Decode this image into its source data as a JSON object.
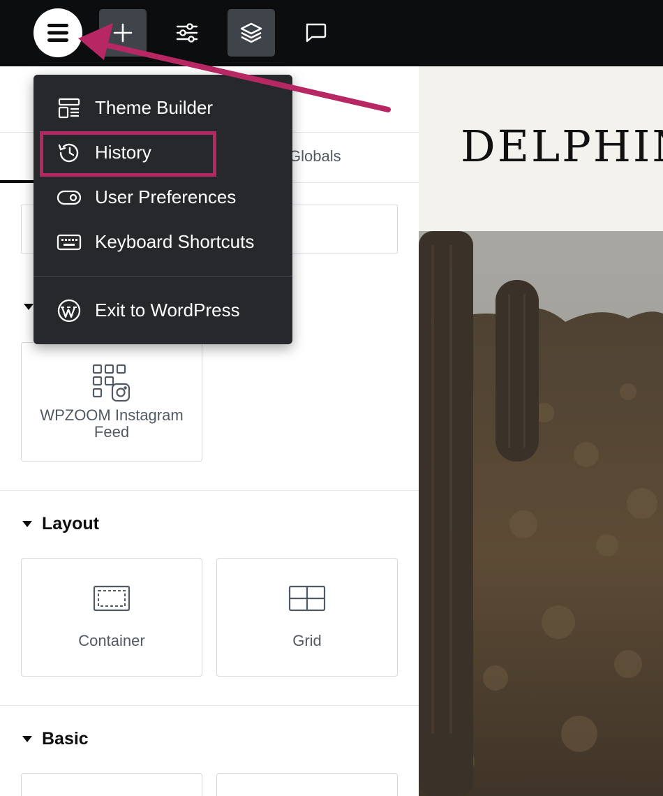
{
  "toolbar": {
    "menu_icon": "hamburger-menu-icon",
    "add_icon": "plus-icon",
    "settings_icon": "sliders-icon",
    "structure_icon": "layers-icon",
    "comments_icon": "comment-icon"
  },
  "panel": {
    "tabs": {
      "globals_label": "Globals"
    },
    "sections": [
      {
        "widgets": [
          {
            "label": "WPZOOM Instagram Feed",
            "icon": "instagram-grid-icon"
          }
        ]
      },
      {
        "title": "Layout",
        "widgets": [
          {
            "label": "Container",
            "icon": "container-icon"
          },
          {
            "label": "Grid",
            "icon": "grid-icon"
          }
        ]
      },
      {
        "title": "Basic",
        "widgets": []
      }
    ]
  },
  "menu": {
    "items": [
      {
        "label": "Theme Builder",
        "icon": "theme-builder-icon"
      },
      {
        "label": "History",
        "icon": "history-icon",
        "highlighted": true
      },
      {
        "label": "User Preferences",
        "icon": "toggle-icon"
      },
      {
        "label": "Keyboard Shortcuts",
        "icon": "keyboard-icon"
      },
      {
        "label": "Exit to WordPress",
        "icon": "wordpress-icon"
      }
    ]
  },
  "preview": {
    "site_title": "DELPHIN"
  },
  "colors": {
    "annotation": "#b72764",
    "topbar": "#0c0d0e",
    "menu_bg": "#26282b",
    "site_header_bg": "#f4f2ed"
  }
}
